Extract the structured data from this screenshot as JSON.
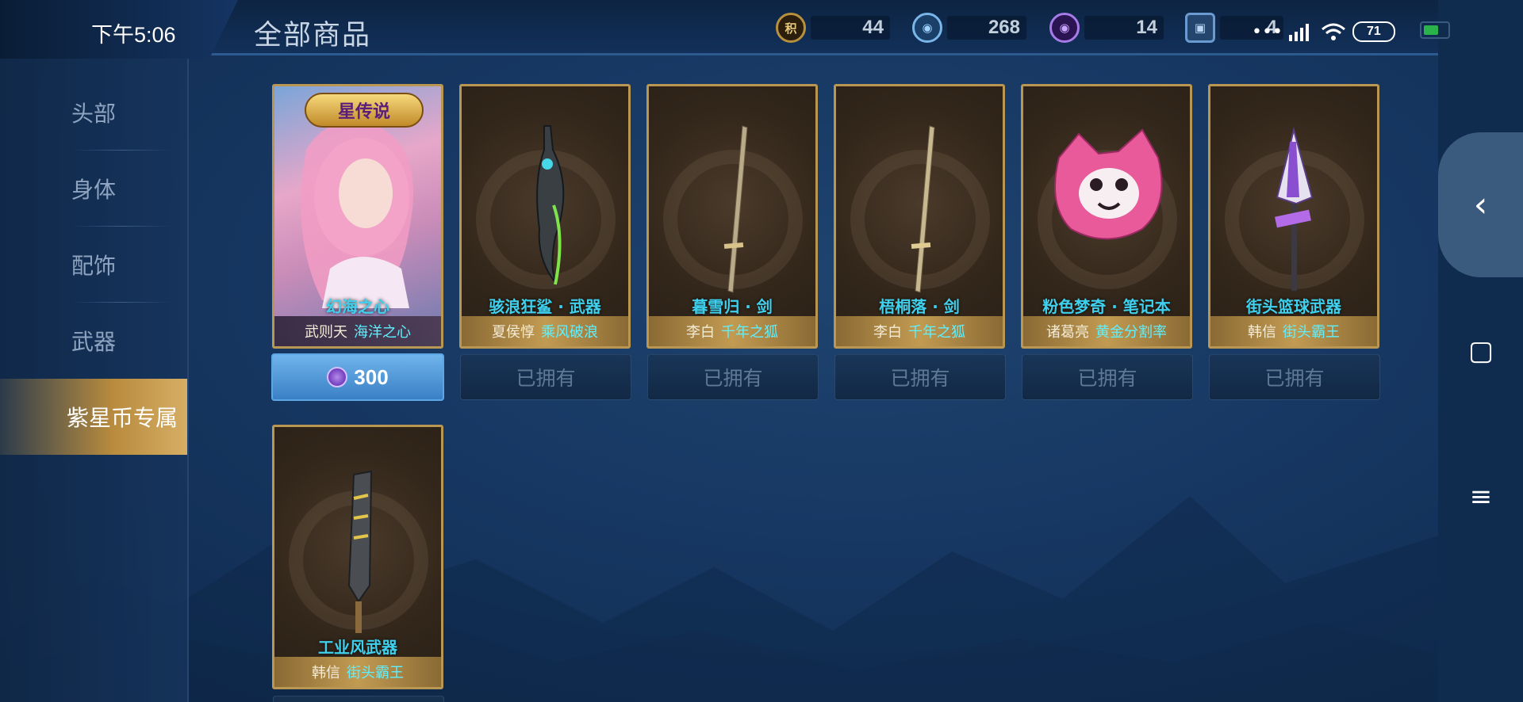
{
  "status": {
    "time": "下午5:06",
    "battery": "71"
  },
  "header": {
    "title": "全部商品"
  },
  "currencies": [
    {
      "icon": "honor-token-icon",
      "glyph": "积",
      "value": "44",
      "color": "#b8913e"
    },
    {
      "icon": "gem-icon",
      "glyph": "◉",
      "value": "268",
      "color": "#2f6fb0"
    },
    {
      "icon": "purple-star-coin-icon",
      "glyph": "◉",
      "value": "14",
      "color": "#7b49c8"
    },
    {
      "icon": "card-ticket-icon",
      "glyph": "▣",
      "value": "4",
      "color": "#4b7bb4"
    }
  ],
  "sidebar": {
    "items": [
      {
        "label": "头部"
      },
      {
        "label": "身体"
      },
      {
        "label": "配饰"
      },
      {
        "label": "武器"
      },
      {
        "label": "紫星币专属"
      }
    ]
  },
  "products": [
    {
      "name": "幻海之心",
      "hero": "武则天",
      "skin": "海洋之心",
      "badge": "星传说",
      "action": "300"
    },
    {
      "name": "骇浪狂鲨 · 武器",
      "hero": "夏侯惇",
      "skin": "乘风破浪",
      "action": "已拥有"
    },
    {
      "name": "暮雪归 · 剑",
      "hero": "李白",
      "skin": "千年之狐",
      "action": "已拥有"
    },
    {
      "name": "梧桐落 · 剑",
      "hero": "李白",
      "skin": "千年之狐",
      "action": "已拥有"
    },
    {
      "name": "粉色梦奇 · 笔记本",
      "hero": "诸葛亮",
      "skin": "黄金分割率",
      "action": "已拥有"
    },
    {
      "name": "街头篮球武器",
      "hero": "韩信",
      "skin": "街头霸王",
      "action": "已拥有"
    },
    {
      "name": "工业风武器",
      "hero": "韩信",
      "skin": "街头霸王"
    }
  ],
  "nav": {
    "back": "‹",
    "home": "▢",
    "menu": "≡"
  }
}
